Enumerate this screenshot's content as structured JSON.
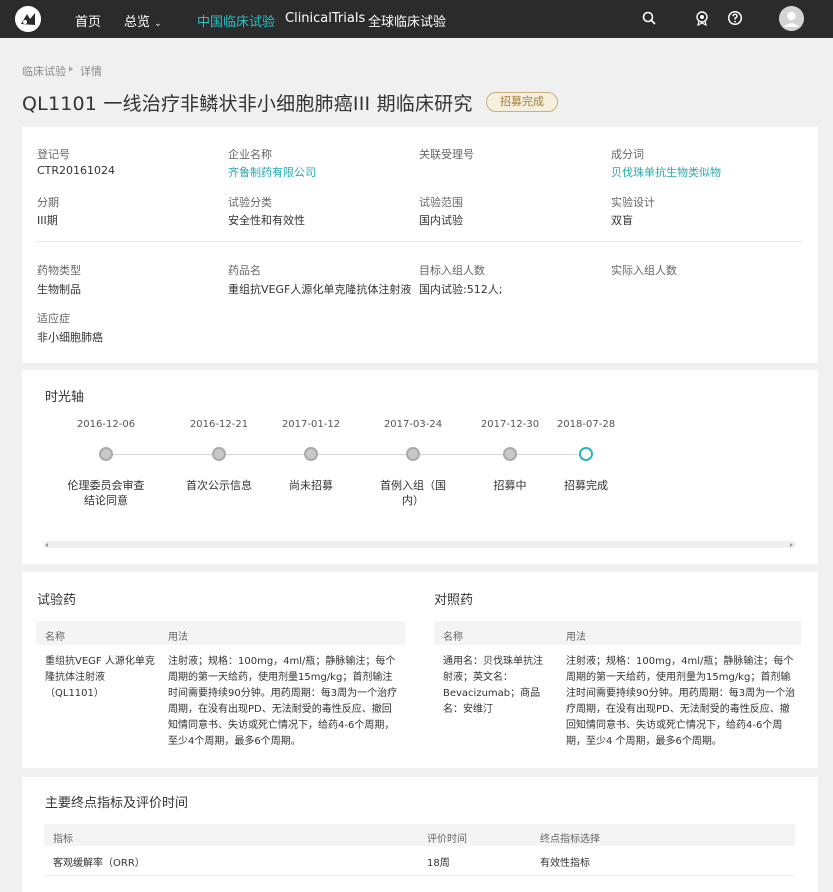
{
  "nav": {
    "home": "首页",
    "overview": "总览",
    "china_trials": "中国临床试验",
    "clinical_trials": "ClinicalTrials",
    "global_trials": "全球临床试验"
  },
  "breadcrumb": {
    "root": "临床试验",
    "current": "详情"
  },
  "page": {
    "title": "QL1101 一线治疗非鳞状非小细胞肺癌III 期临床研究",
    "status": "招募完成"
  },
  "info": {
    "reg_no_label": "登记号",
    "reg_no": "CTR20161024",
    "company_label": "企业名称",
    "company": "齐鲁制药有限公司",
    "related_label": "关联受理号",
    "related": "",
    "ingredient_label": "成分词",
    "ingredient": "贝伐珠单抗生物类似物",
    "phase_label": "分期",
    "phase": "III期",
    "category_label": "试验分类",
    "category": "安全性和有效性",
    "scope_label": "试验范围",
    "scope": "国内试验",
    "design_label": "实验设计",
    "design": "双盲",
    "drug_type_label": "药物类型",
    "drug_type": "生物制品",
    "drug_name_label": "药品名",
    "drug_name": "重组抗VEGF人源化单克隆抗体注射液",
    "target_label": "目标入组人数",
    "target": "国内试验:512人;",
    "actual_label": "实际入组人数",
    "actual": "",
    "indication_label": "适应症",
    "indication": "非小细胞肺癌"
  },
  "timeline": {
    "title": "时光轴",
    "events": [
      {
        "date": "2016-12-06",
        "label": "伦理委员会审查结论同意"
      },
      {
        "date": "2016-12-21",
        "label": "首次公示信息"
      },
      {
        "date": "2017-01-12",
        "label": "尚未招募"
      },
      {
        "date": "2017-03-24",
        "label": "首例入组（国内）"
      },
      {
        "date": "2017-12-30",
        "label": "招募中"
      },
      {
        "date": "2018-07-28",
        "label": "招募完成"
      }
    ]
  },
  "drugs": {
    "test": {
      "title": "试验药",
      "name_header": "名称",
      "usage_header": "用法",
      "name": "重组抗VEGF 人源化单克隆抗体注射液（QL1101）",
      "usage": "注射液；规格：100mg，4ml/瓶；静脉输注；每个周期的第一天给药，使用剂量15mg/kg；首剂输注时间需要持续90分钟。用药周期：每3周为一个治疗周期，在没有出现PD、无法耐受的毒性反应、撤回知情同意书、失访或死亡情况下，给药4-6个周期，至少4个周期，最多6个周期。"
    },
    "control": {
      "title": "对照药",
      "name_header": "名称",
      "usage_header": "用法",
      "name": "通用名：贝伐珠单抗注射液；英文名：Bevacizumab；商品名：安维汀",
      "usage": "注射液；规格：100mg，4ml/瓶；静脉输注；每个周期的第一天给药，使用剂量为15mg/kg；首剂输注时间需要持续90分钟。用药周期：每3周为一个治疗周期，在没有出现PD、无法耐受的毒性反应、撤回知情同意书、失访或死亡情况下，给药4-6个周期，至少4 个周期，最多6个周期。"
    }
  },
  "endpoints": {
    "title": "主要终点指标及评价时间",
    "headers": [
      "指标",
      "评价时间",
      "终点指标选择"
    ],
    "rows": [
      {
        "indicator": "客观缓解率（ORR）",
        "time": "18周",
        "type": "有效性指标"
      }
    ]
  }
}
